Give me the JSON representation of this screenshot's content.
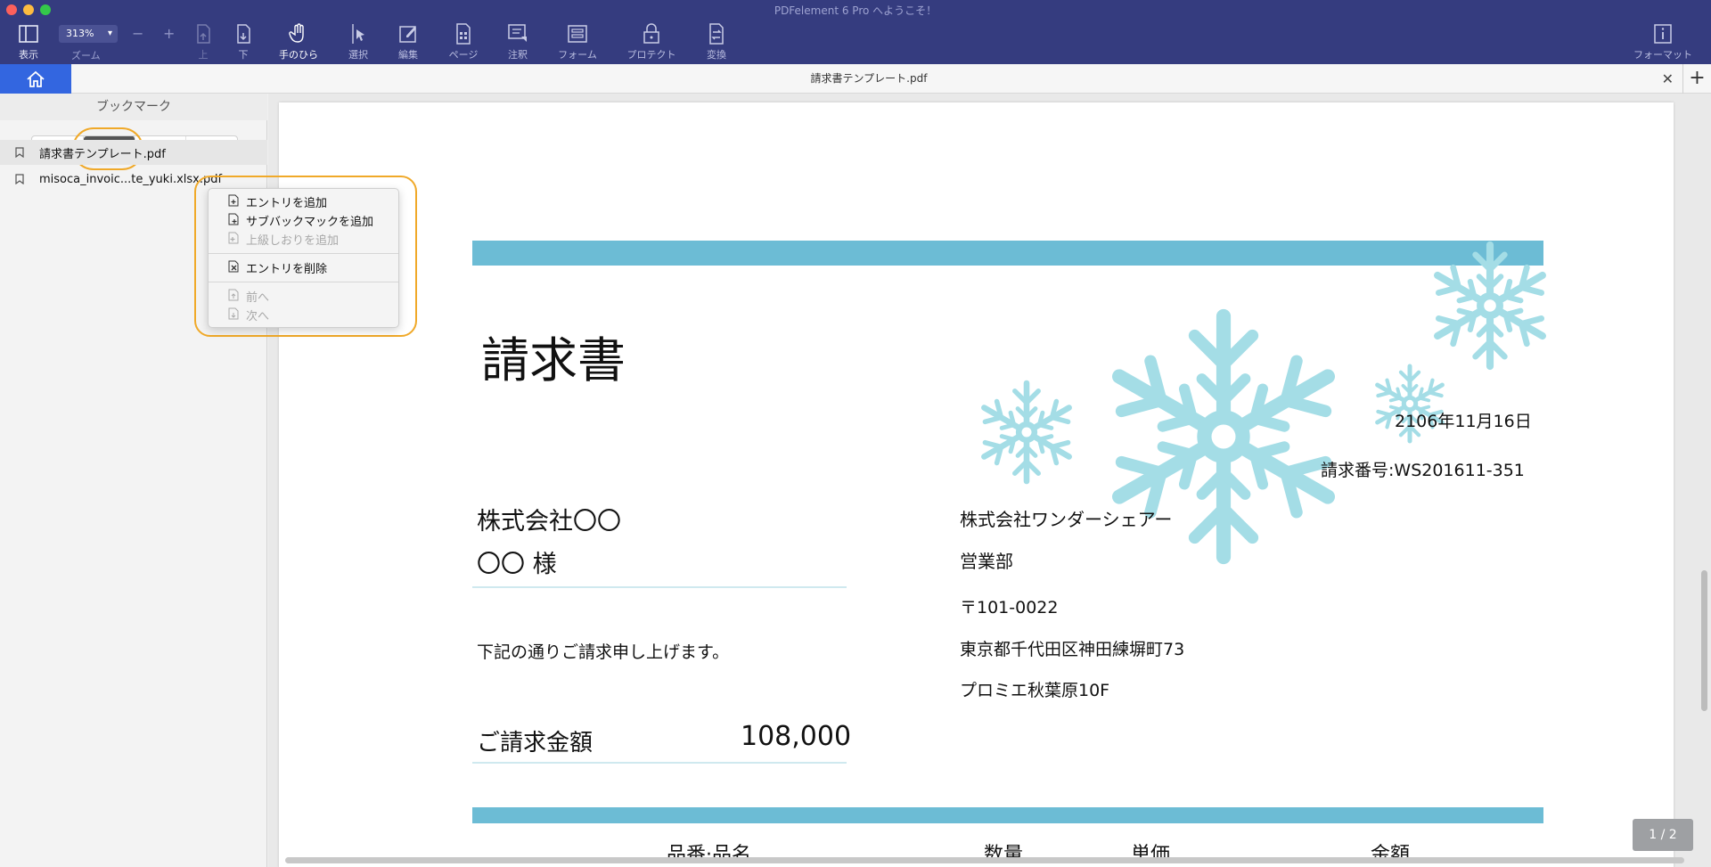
{
  "window": {
    "title": "PDFelement 6 Pro へようこそ！"
  },
  "toolbar": {
    "view_label": "表示",
    "zoom_value": "313%",
    "zoom_label": "ズーム",
    "up_label": "上",
    "down_label": "下",
    "hand_label": "手のひら",
    "select_label": "選択",
    "edit_label": "編集",
    "page_label": "ページ",
    "comment_label": "注釈",
    "form_label": "フォーム",
    "protect_label": "プロテクト",
    "convert_label": "変換",
    "format_label": "フォーマット"
  },
  "tab": {
    "title": "請求書テンプレート.pdf"
  },
  "sidebar": {
    "title": "ブックマーク",
    "bookmarks": [
      {
        "label": "請求書テンプレート.pdf"
      },
      {
        "label": "misoca_invoic...te_yuki.xlsx.pdf"
      }
    ]
  },
  "context_menu": {
    "items": [
      {
        "label": "エントリを追加"
      },
      {
        "label": "サブバックマックを追加"
      },
      {
        "label": "上級しおりを追加"
      },
      {
        "label": "エントリを削除"
      },
      {
        "label": "前へ"
      },
      {
        "label": "次へ"
      }
    ]
  },
  "invoice": {
    "title": "請求書",
    "date": "2106年11月16日",
    "number": "請求番号:WS201611-351",
    "client_company": "株式会社〇〇",
    "client_name": "〇〇 様",
    "intro": "下記の通りご請求申し上げます。",
    "amount_label": "ご請求金額",
    "amount_value": "108,000",
    "sender_company": "株式会社ワンダーシェアー",
    "sender_dept": "営業部",
    "sender_zip": "〒101-0022",
    "sender_address": "東京都千代田区神田練塀町73",
    "sender_building": "プロミエ秋葉原10F",
    "col_item": "品番·品名",
    "col_qty": "数量",
    "col_price": "単価",
    "col_amount": "金額"
  },
  "page_indicator": "1 / 2",
  "colors": {
    "toolbar_bg": "#353c7f",
    "accent_blue": "#3366e0",
    "band_blue": "#6cbcd5",
    "snowflake": "#a4dde6",
    "highlight_orange": "#f0a929"
  }
}
